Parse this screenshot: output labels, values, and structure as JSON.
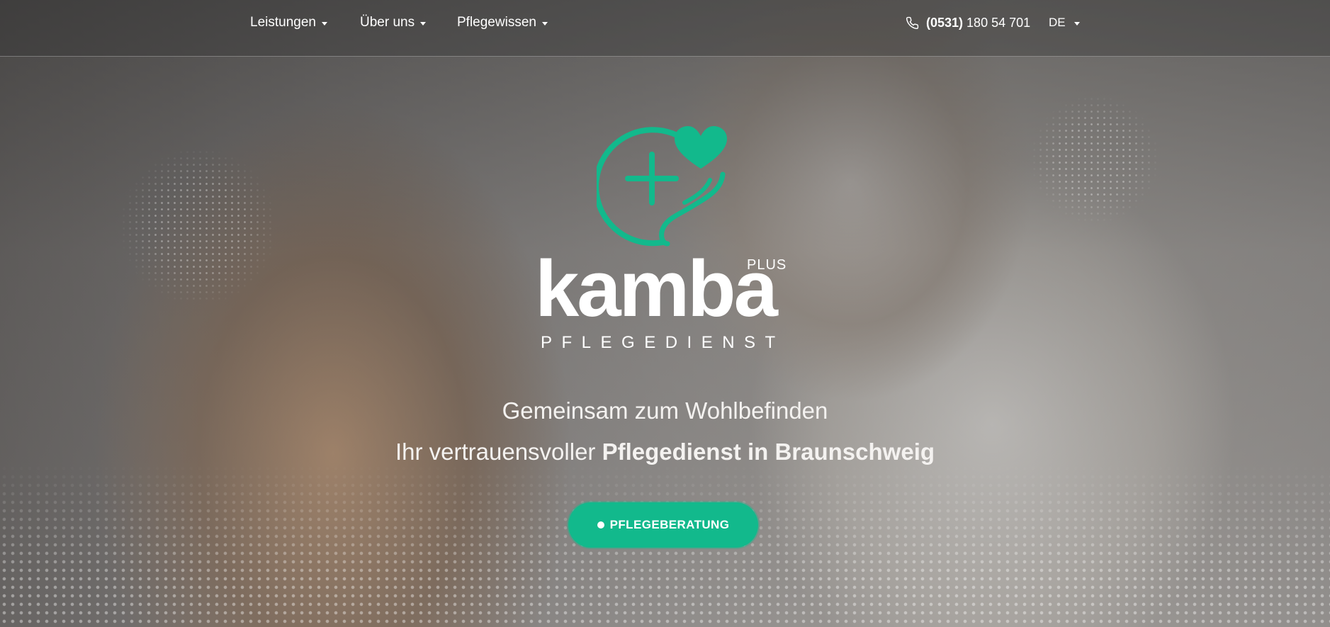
{
  "nav": {
    "items": [
      {
        "label": "Leistungen"
      },
      {
        "label": "Über uns"
      },
      {
        "label": "Pflegewissen"
      }
    ],
    "phone_area": "(0531)",
    "phone_number": "180 54 701",
    "language": "DE"
  },
  "brand": {
    "name": "kamba",
    "plus": "PLUS",
    "subtitle": "PFLEGEDIENST"
  },
  "hero": {
    "tagline": "Gemeinsam zum Wohlbefinden",
    "subtagline_prefix": "Ihr vertrauensvoller",
    "subtagline_bold": "Pflegedienst in Braunschweig",
    "cta_label": "PFLEGEBERATUNG"
  },
  "colors": {
    "accent": "#12b98c",
    "text": "#ffffff"
  }
}
